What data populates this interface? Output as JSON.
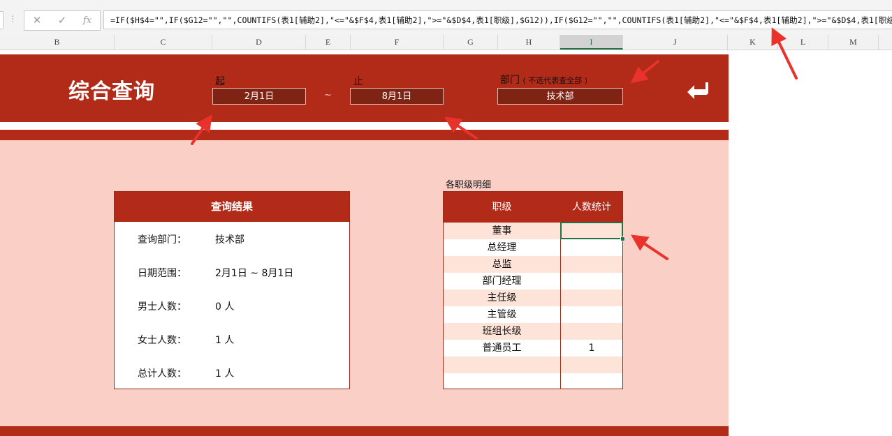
{
  "formula_bar": {
    "grip": "⋮",
    "cancel": "✕",
    "enter": "✓",
    "fx": "fx",
    "formula": "=IF($H$4=\"\",IF($G12=\"\",\"\",COUNTIFS(表1[辅助2],\"<=\"&$F$4,表1[辅助2],\">=\"&$D$4,表1[职级],$G12)),IF($G12=\"\",\"\",COUNTIFS(表1[辅助2],\"<=\"&$F$4,表1[辅助2],\">=\"&$D$4,表1[职级]"
  },
  "columns": [
    "B",
    "C",
    "D",
    "E",
    "F",
    "G",
    "H",
    "I",
    "J",
    "K",
    "L",
    "M"
  ],
  "selected_column": "I",
  "banner": {
    "title": "综合查询",
    "start_label": "起",
    "start_value": "2月1日",
    "tilde": "~",
    "end_label": "止",
    "end_value": "8月1日",
    "dept_label": "部门",
    "dept_hint": "( 不选代表查全部 )",
    "dept_value": "技术部",
    "return_icon": "return-arrow-icon"
  },
  "result_card": {
    "title": "查询结果",
    "rows": [
      {
        "label": "查询部门：",
        "value": "技术部"
      },
      {
        "label": "日期范围：",
        "value": "2月1日 ~ 8月1日"
      },
      {
        "label": "男士人数：",
        "value": "0 人"
      },
      {
        "label": "女士人数：",
        "value": "1 人"
      },
      {
        "label": "总计人数：",
        "value": "1 人"
      }
    ]
  },
  "rank_table": {
    "title": "各职级明细",
    "headers": [
      "职级",
      "人数统计"
    ],
    "rows": [
      {
        "rank": "董事",
        "count": ""
      },
      {
        "rank": "总经理",
        "count": ""
      },
      {
        "rank": "总监",
        "count": ""
      },
      {
        "rank": "部门经理",
        "count": ""
      },
      {
        "rank": "主任级",
        "count": ""
      },
      {
        "rank": "主管级",
        "count": ""
      },
      {
        "rank": "班组长级",
        "count": ""
      },
      {
        "rank": "普通员工",
        "count": "1"
      },
      {
        "rank": "",
        "count": ""
      },
      {
        "rank": "",
        "count": ""
      }
    ]
  },
  "colors": {
    "accent": "#b22a18",
    "pink_background": "#f9cfc6",
    "selection": "#217346",
    "annotation_arrow": "#e8322b"
  }
}
